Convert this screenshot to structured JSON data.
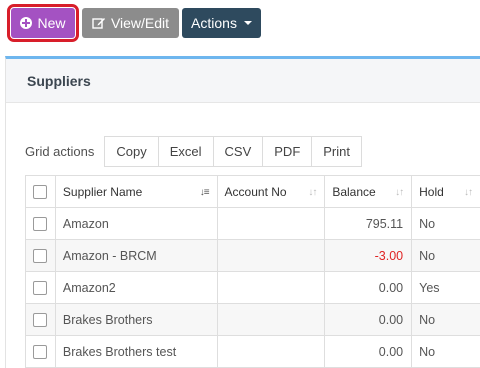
{
  "toolbar": {
    "new_label": "New",
    "view_edit_label": "View/Edit",
    "actions_label": "Actions"
  },
  "panel": {
    "title": "Suppliers"
  },
  "grid_actions": {
    "label": "Grid actions",
    "buttons": [
      "Copy",
      "Excel",
      "CSV",
      "PDF",
      "Print"
    ]
  },
  "table": {
    "columns": [
      "Supplier Name",
      "Account No",
      "Balance",
      "Hold"
    ],
    "rows": [
      {
        "name": "Amazon",
        "account": "",
        "balance": "795.11",
        "hold": "No"
      },
      {
        "name": "Amazon - BRCM",
        "account": "",
        "balance": "-3.00",
        "hold": "No"
      },
      {
        "name": "Amazon2",
        "account": "",
        "balance": "0.00",
        "hold": "Yes"
      },
      {
        "name": "Brakes Brothers",
        "account": "",
        "balance": "0.00",
        "hold": "No"
      },
      {
        "name": "Brakes Brothers test",
        "account": "",
        "balance": "0.00",
        "hold": "No"
      }
    ]
  },
  "colors": {
    "new_button": "#a452c2",
    "view_button": "#8c8c8c",
    "actions_button": "#2e4a5e",
    "highlight_outline": "#d81e2a",
    "panel_accent": "#6eb6ee",
    "negative_value": "#e02424"
  },
  "icons": {
    "new": "plus-circle-icon",
    "view_edit": "edit-icon",
    "actions": "caret-down-icon",
    "sort": "sort-icon"
  }
}
